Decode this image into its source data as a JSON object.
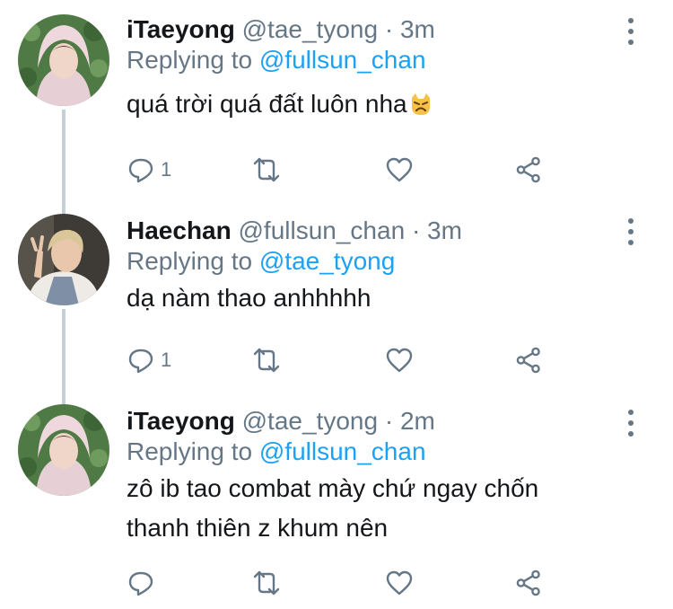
{
  "tweets": [
    {
      "name": "iTaeyong",
      "handle": "@tae_tyong",
      "dot": "·",
      "time": "3m",
      "replying_label": "Replying to",
      "replying_handle": "@fullsun_chan",
      "text": "quá trời quá đất luôn nha",
      "emoji": "cat-face-emoji",
      "reply_count": "1"
    },
    {
      "name": "Haechan",
      "handle": "@fullsun_chan",
      "dot": "·",
      "time": "3m",
      "replying_label": "Replying to",
      "replying_handle": "@tae_tyong",
      "text": "dạ nàm thao anhhhhh",
      "reply_count": "1"
    },
    {
      "name": "iTaeyong",
      "handle": "@tae_tyong",
      "dot": "·",
      "time": "2m",
      "replying_label": "Replying to",
      "replying_handle": "@fullsun_chan",
      "text": "zô ib tao combat mày chứ ngay chốn\nthanh thiên z khum nên",
      "reply_count": ""
    }
  ],
  "icons": {
    "reply": "reply-icon",
    "retweet": "retweet-icon",
    "like": "heart-icon",
    "share": "share-icon",
    "more": "more-options-icon"
  },
  "colors": {
    "accent": "#1da1f2",
    "secondary_text": "#657786",
    "primary_text": "#14171a",
    "thread_line": "#c4cfd6"
  }
}
